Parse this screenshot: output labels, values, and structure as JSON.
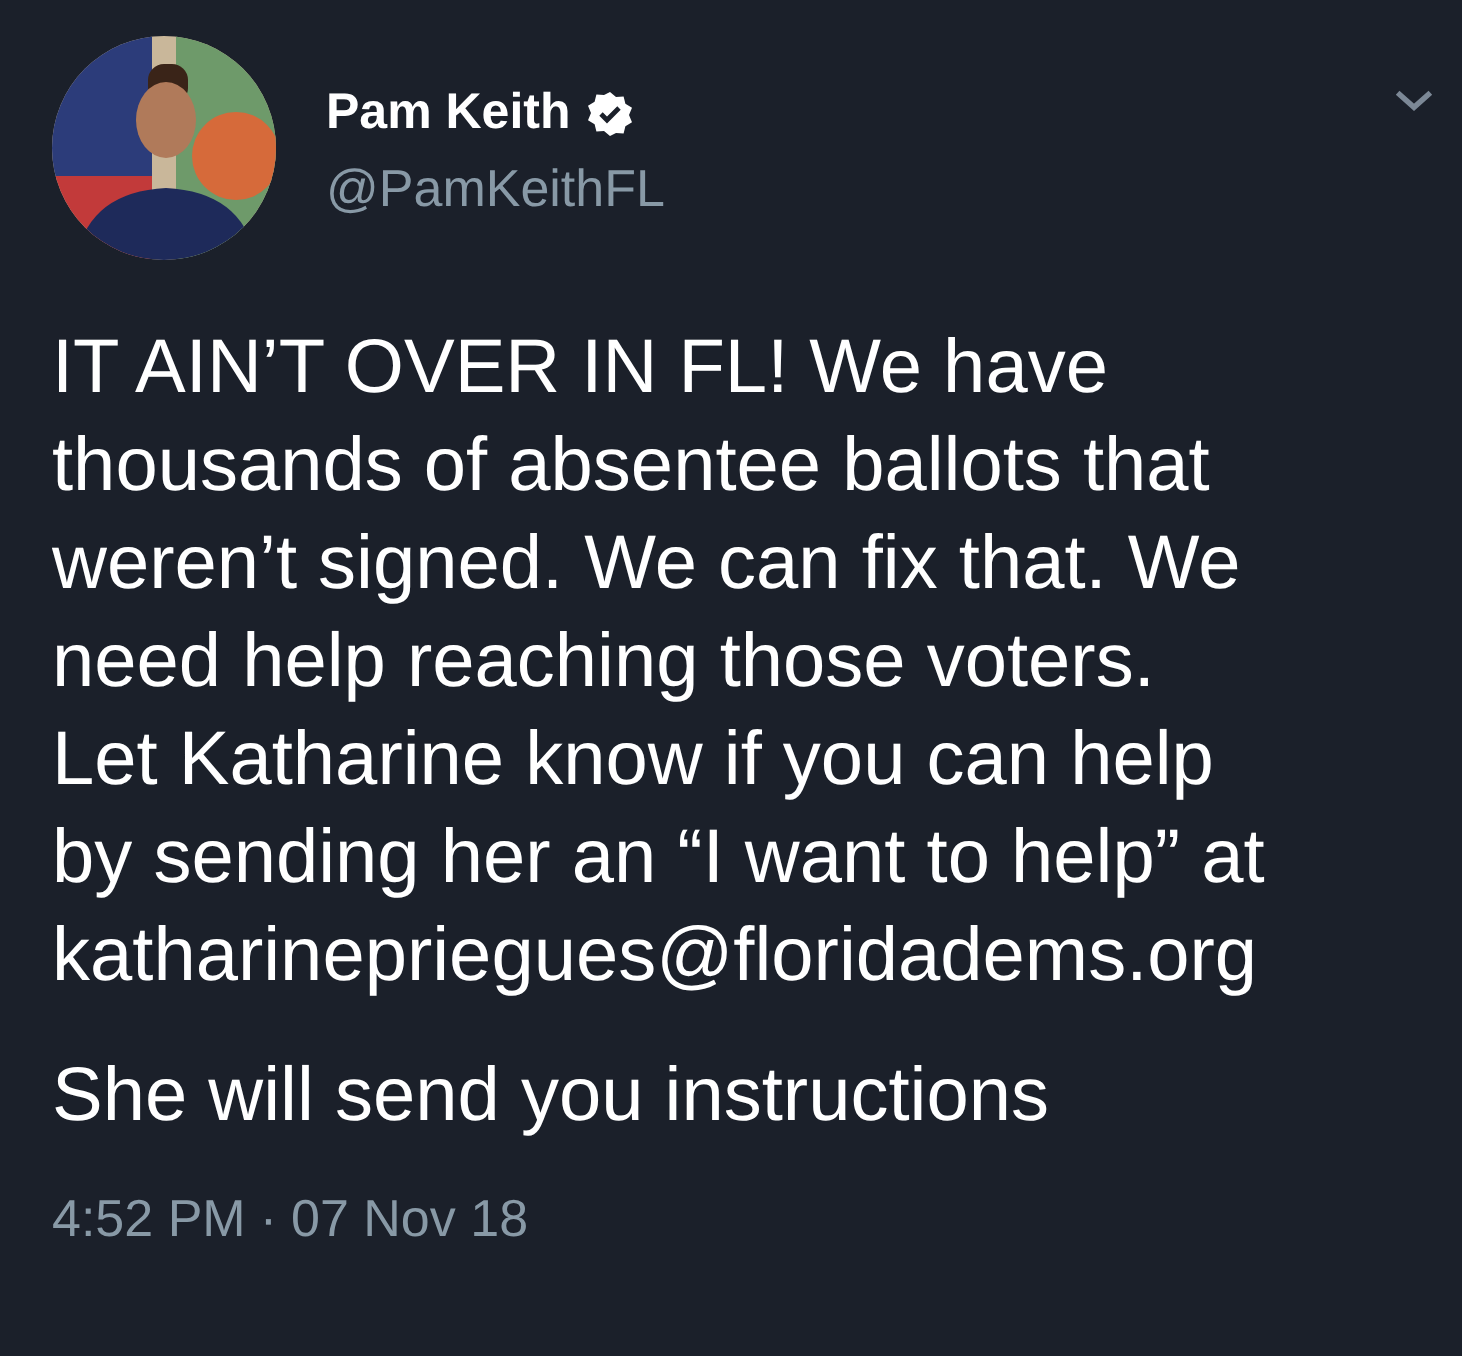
{
  "tweet": {
    "name": "Pam Keith",
    "verified": true,
    "handle": "@PamKeithFL",
    "paragraphs": [
      "IT AIN’T OVER IN FL! We have\nthousands of absentee ballots that\nweren’t signed. We can fix that. We\nneed help reaching those voters.\nLet Katharine know if you can help\nby sending her an “I want to help” at\nkatharinepriegues@floridadems.org",
      "She will send you instructions"
    ],
    "time": "4:52 PM",
    "separator": "·",
    "date": "07 Nov 18"
  }
}
